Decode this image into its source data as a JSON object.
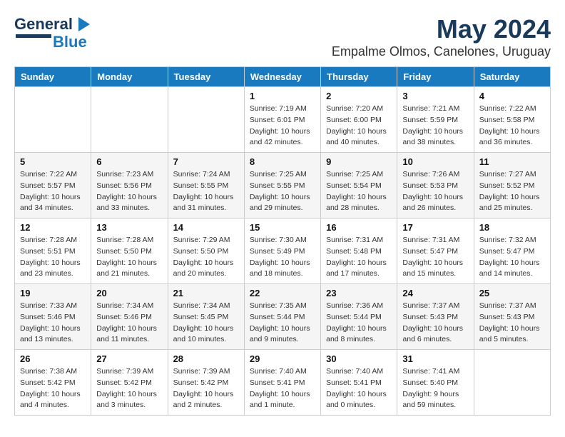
{
  "logo": {
    "line1": "General",
    "line2": "Blue",
    "arrow": "▶"
  },
  "title": "May 2024",
  "location": "Empalme Olmos, Canelones, Uruguay",
  "headers": [
    "Sunday",
    "Monday",
    "Tuesday",
    "Wednesday",
    "Thursday",
    "Friday",
    "Saturday"
  ],
  "weeks": [
    [
      {
        "day": "",
        "info": ""
      },
      {
        "day": "",
        "info": ""
      },
      {
        "day": "",
        "info": ""
      },
      {
        "day": "1",
        "info": "Sunrise: 7:19 AM\nSunset: 6:01 PM\nDaylight: 10 hours\nand 42 minutes."
      },
      {
        "day": "2",
        "info": "Sunrise: 7:20 AM\nSunset: 6:00 PM\nDaylight: 10 hours\nand 40 minutes."
      },
      {
        "day": "3",
        "info": "Sunrise: 7:21 AM\nSunset: 5:59 PM\nDaylight: 10 hours\nand 38 minutes."
      },
      {
        "day": "4",
        "info": "Sunrise: 7:22 AM\nSunset: 5:58 PM\nDaylight: 10 hours\nand 36 minutes."
      }
    ],
    [
      {
        "day": "5",
        "info": "Sunrise: 7:22 AM\nSunset: 5:57 PM\nDaylight: 10 hours\nand 34 minutes."
      },
      {
        "day": "6",
        "info": "Sunrise: 7:23 AM\nSunset: 5:56 PM\nDaylight: 10 hours\nand 33 minutes."
      },
      {
        "day": "7",
        "info": "Sunrise: 7:24 AM\nSunset: 5:55 PM\nDaylight: 10 hours\nand 31 minutes."
      },
      {
        "day": "8",
        "info": "Sunrise: 7:25 AM\nSunset: 5:55 PM\nDaylight: 10 hours\nand 29 minutes."
      },
      {
        "day": "9",
        "info": "Sunrise: 7:25 AM\nSunset: 5:54 PM\nDaylight: 10 hours\nand 28 minutes."
      },
      {
        "day": "10",
        "info": "Sunrise: 7:26 AM\nSunset: 5:53 PM\nDaylight: 10 hours\nand 26 minutes."
      },
      {
        "day": "11",
        "info": "Sunrise: 7:27 AM\nSunset: 5:52 PM\nDaylight: 10 hours\nand 25 minutes."
      }
    ],
    [
      {
        "day": "12",
        "info": "Sunrise: 7:28 AM\nSunset: 5:51 PM\nDaylight: 10 hours\nand 23 minutes."
      },
      {
        "day": "13",
        "info": "Sunrise: 7:28 AM\nSunset: 5:50 PM\nDaylight: 10 hours\nand 21 minutes."
      },
      {
        "day": "14",
        "info": "Sunrise: 7:29 AM\nSunset: 5:50 PM\nDaylight: 10 hours\nand 20 minutes."
      },
      {
        "day": "15",
        "info": "Sunrise: 7:30 AM\nSunset: 5:49 PM\nDaylight: 10 hours\nand 18 minutes."
      },
      {
        "day": "16",
        "info": "Sunrise: 7:31 AM\nSunset: 5:48 PM\nDaylight: 10 hours\nand 17 minutes."
      },
      {
        "day": "17",
        "info": "Sunrise: 7:31 AM\nSunset: 5:47 PM\nDaylight: 10 hours\nand 15 minutes."
      },
      {
        "day": "18",
        "info": "Sunrise: 7:32 AM\nSunset: 5:47 PM\nDaylight: 10 hours\nand 14 minutes."
      }
    ],
    [
      {
        "day": "19",
        "info": "Sunrise: 7:33 AM\nSunset: 5:46 PM\nDaylight: 10 hours\nand 13 minutes."
      },
      {
        "day": "20",
        "info": "Sunrise: 7:34 AM\nSunset: 5:46 PM\nDaylight: 10 hours\nand 11 minutes."
      },
      {
        "day": "21",
        "info": "Sunrise: 7:34 AM\nSunset: 5:45 PM\nDaylight: 10 hours\nand 10 minutes."
      },
      {
        "day": "22",
        "info": "Sunrise: 7:35 AM\nSunset: 5:44 PM\nDaylight: 10 hours\nand 9 minutes."
      },
      {
        "day": "23",
        "info": "Sunrise: 7:36 AM\nSunset: 5:44 PM\nDaylight: 10 hours\nand 8 minutes."
      },
      {
        "day": "24",
        "info": "Sunrise: 7:37 AM\nSunset: 5:43 PM\nDaylight: 10 hours\nand 6 minutes."
      },
      {
        "day": "25",
        "info": "Sunrise: 7:37 AM\nSunset: 5:43 PM\nDaylight: 10 hours\nand 5 minutes."
      }
    ],
    [
      {
        "day": "26",
        "info": "Sunrise: 7:38 AM\nSunset: 5:42 PM\nDaylight: 10 hours\nand 4 minutes."
      },
      {
        "day": "27",
        "info": "Sunrise: 7:39 AM\nSunset: 5:42 PM\nDaylight: 10 hours\nand 3 minutes."
      },
      {
        "day": "28",
        "info": "Sunrise: 7:39 AM\nSunset: 5:42 PM\nDaylight: 10 hours\nand 2 minutes."
      },
      {
        "day": "29",
        "info": "Sunrise: 7:40 AM\nSunset: 5:41 PM\nDaylight: 10 hours\nand 1 minute."
      },
      {
        "day": "30",
        "info": "Sunrise: 7:40 AM\nSunset: 5:41 PM\nDaylight: 10 hours\nand 0 minutes."
      },
      {
        "day": "31",
        "info": "Sunrise: 7:41 AM\nSunset: 5:40 PM\nDaylight: 9 hours\nand 59 minutes."
      },
      {
        "day": "",
        "info": ""
      }
    ]
  ]
}
